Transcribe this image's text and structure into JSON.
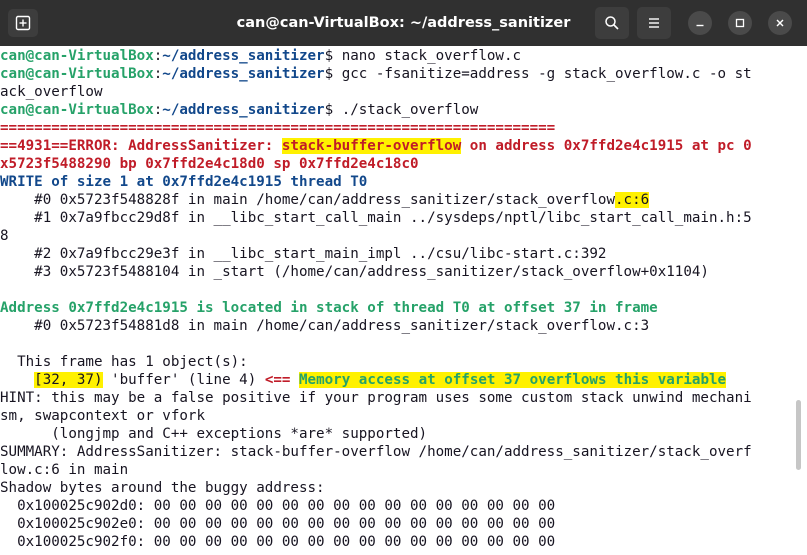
{
  "window": {
    "title": "can@can-VirtualBox: ~/address_sanitizer"
  },
  "prompt": {
    "user": "can@can-VirtualBox",
    "sep": ":",
    "path": "~/address_sanitizer",
    "dollar": "$ "
  },
  "commands": {
    "c1": "nano stack_overflow.c",
    "c2": "gcc -fsanitize=address -g stack_overflow.c -o st",
    "c2b": "ack_overflow",
    "c3": "./stack_overflow"
  },
  "output": {
    "sep": "=================================================================",
    "e1a": "==4931==ERROR: AddressSanitizer: ",
    "e1hl": "stack-buffer-overflow",
    "e1b": " on address 0x7ffd2e4c1915 at pc 0",
    "e2": "x5723f5488290 bp 0x7ffd2e4c18d0 sp 0x7ffd2e4c18c0",
    "w1": "WRITE of size 1 at 0x7ffd2e4c1915 thread T0",
    "f0a": "    #0 0x5723f548828f in main /home/can/address_sanitizer/stack_overflow",
    "f0hl": ".c:6",
    "f1": "    #1 0x7a9fbcc29d8f in __libc_start_call_main ../sysdeps/nptl/libc_start_call_main.h:5",
    "f1b": "8",
    "f2": "    #2 0x7a9fbcc29e3f in __libc_start_main_impl ../csu/libc-start.c:392",
    "f3": "    #3 0x5723f5488104 in _start (/home/can/address_sanitizer/stack_overflow+0x1104)",
    "addr": "Address 0x7ffd2e4c1915 is located in stack of thread T0 at offset 37 in frame",
    "af0": "    #0 0x5723f54881d8 in main /home/can/address_sanitizer/stack_overflow.c:3",
    "frame": "  This frame has 1 object(s):",
    "obj_indent": "    ",
    "obj_range": "[32, 37)",
    "obj_mid": " 'buffer' (line 4) ",
    "obj_arrow": "<== ",
    "obj_msg": "Memory access at offset 37 overflows this variable",
    "h1": "HINT: this may be a false positive if your program uses some custom stack unwind mechani",
    "h2": "sm, swapcontext or vfork",
    "h3": "      (longjmp and C++ exceptions *are* supported)",
    "s1": "SUMMARY: AddressSanitizer: stack-buffer-overflow /home/can/address_sanitizer/stack_overf",
    "s2": "low.c:6 in main",
    "sh": "Shadow bytes around the buggy address:",
    "r1": "  0x100025c902d0: 00 00 00 00 00 00 00 00 00 00 00 00 00 00 00 00",
    "r2": "  0x100025c902e0: 00 00 00 00 00 00 00 00 00 00 00 00 00 00 00 00",
    "r3": "  0x100025c902f0: 00 00 00 00 00 00 00 00 00 00 00 00 00 00 00 00"
  },
  "icons": [
    "new-tab-icon",
    "search-icon",
    "menu-icon",
    "minimize-icon",
    "maximize-icon",
    "close-icon"
  ],
  "colors": {
    "prompt_user": "#26a269",
    "prompt_path": "#12488b",
    "error": "#c01c28",
    "highlight": "#fff100",
    "titlebar": "#303030"
  }
}
